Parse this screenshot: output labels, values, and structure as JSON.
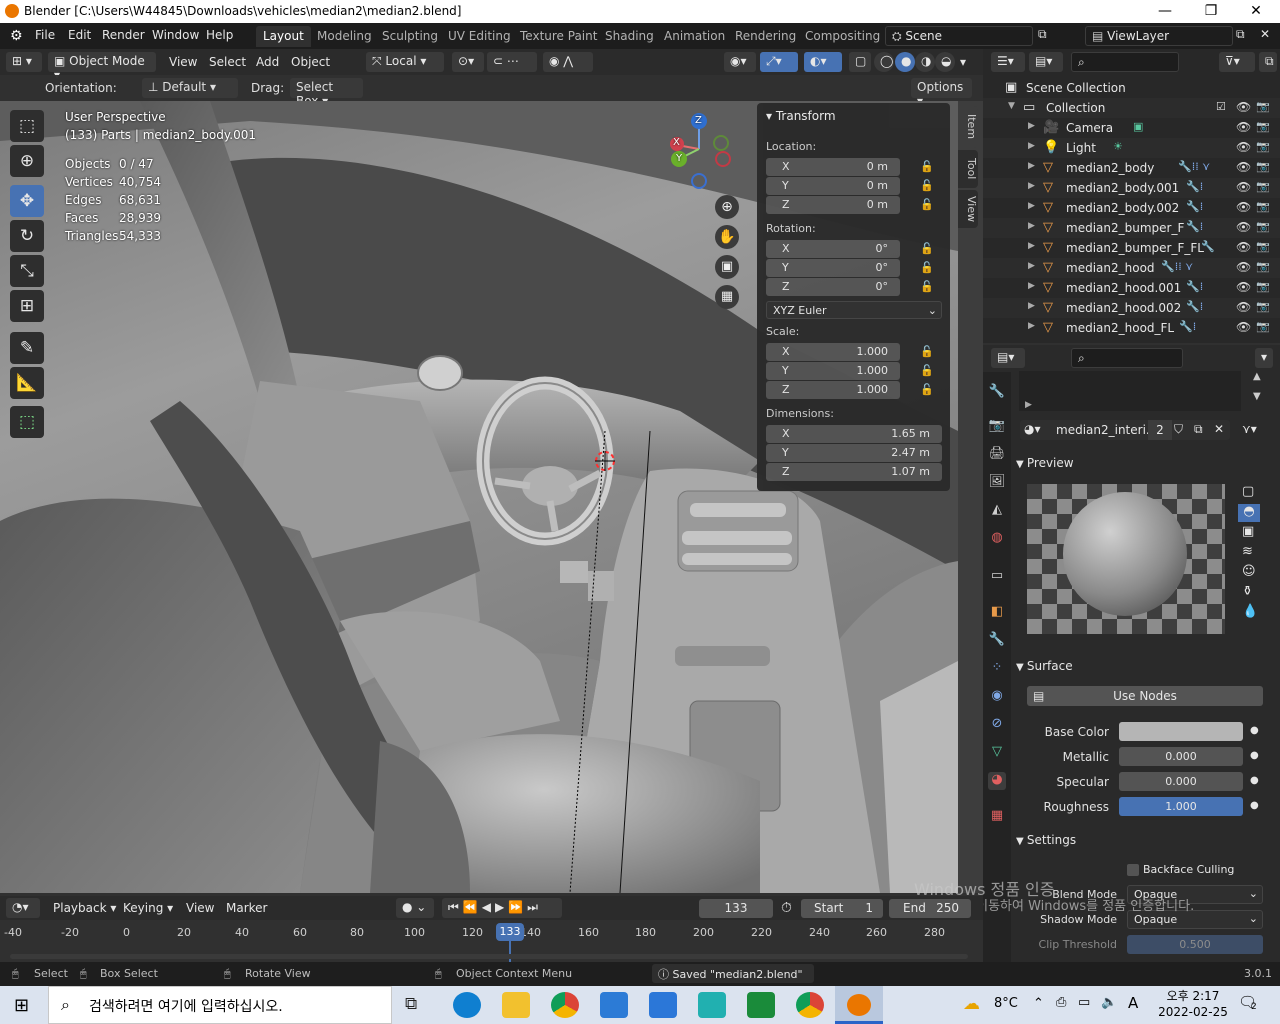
{
  "window": {
    "title": "Blender [C:\\Users\\W44845\\Downloads\\vehicles\\median2\\median2.blend]",
    "min": "—",
    "max": "❐",
    "close": "✕"
  },
  "menu": [
    "File",
    "Edit",
    "Render",
    "Window",
    "Help"
  ],
  "workspaces": [
    "Layout",
    "Modeling",
    "Sculpting",
    "UV Editing",
    "Texture Paint",
    "Shading",
    "Animation",
    "Rendering",
    "Compositing"
  ],
  "scene": {
    "name": "Scene",
    "view_layer": "ViewLayer"
  },
  "viewport_header": {
    "mode": "Object Mode",
    "menus": [
      "View",
      "Select",
      "Add",
      "Object"
    ],
    "transform_space": "Local"
  },
  "tool_settings": {
    "orientation_label": "Orientation:",
    "orientation": "Default",
    "drag_label": "Drag:",
    "drag": "Select Box",
    "options": "Options"
  },
  "viewport_info": {
    "perspective": "User Perspective",
    "object": "(133) Parts | median2_body.001",
    "stats": [
      {
        "label": "Objects",
        "value": "0 / 47"
      },
      {
        "label": "Vertices",
        "value": "40,754"
      },
      {
        "label": "Edges",
        "value": "68,631"
      },
      {
        "label": "Faces",
        "value": "28,939"
      },
      {
        "label": "Triangles",
        "value": "54,333"
      }
    ]
  },
  "gizmo": {
    "x": "X",
    "y": "Y",
    "z": "Z"
  },
  "npanel": {
    "header": "Transform",
    "location_label": "Location:",
    "location": [
      {
        "axis": "X",
        "value": "0 m"
      },
      {
        "axis": "Y",
        "value": "0 m"
      },
      {
        "axis": "Z",
        "value": "0 m"
      }
    ],
    "rotation_label": "Rotation:",
    "rotation": [
      {
        "axis": "X",
        "value": "0°"
      },
      {
        "axis": "Y",
        "value": "0°"
      },
      {
        "axis": "Z",
        "value": "0°"
      }
    ],
    "rotation_mode": "XYZ Euler",
    "scale_label": "Scale:",
    "scale": [
      {
        "axis": "X",
        "value": "1.000"
      },
      {
        "axis": "Y",
        "value": "1.000"
      },
      {
        "axis": "Z",
        "value": "1.000"
      }
    ],
    "dimensions_label": "Dimensions:",
    "dimensions": [
      {
        "axis": "X",
        "value": "1.65 m"
      },
      {
        "axis": "Y",
        "value": "2.47 m"
      },
      {
        "axis": "Z",
        "value": "1.07 m"
      }
    ],
    "tabs": [
      "Item",
      "Tool",
      "View"
    ]
  },
  "outliner": {
    "scene_collection": "Scene Collection",
    "collection": "Collection",
    "items": [
      {
        "name": "Camera",
        "icon": "camera-icon"
      },
      {
        "name": "Light",
        "icon": "light-icon"
      },
      {
        "name": "median2_body",
        "icon": "mesh-icon"
      },
      {
        "name": "median2_body.001",
        "icon": "mesh-icon"
      },
      {
        "name": "median2_body.002",
        "icon": "mesh-icon"
      },
      {
        "name": "median2_bumper_F",
        "icon": "mesh-icon"
      },
      {
        "name": "median2_bumper_F_FL",
        "icon": "mesh-icon"
      },
      {
        "name": "median2_hood",
        "icon": "mesh-icon"
      },
      {
        "name": "median2_hood.001",
        "icon": "mesh-icon"
      },
      {
        "name": "median2_hood.002",
        "icon": "mesh-icon"
      },
      {
        "name": "median2_hood_FL",
        "icon": "mesh-icon"
      }
    ]
  },
  "properties": {
    "material_name": "median2_interi...",
    "material_users": "2",
    "preview_label": "Preview",
    "surface_label": "Surface",
    "use_nodes": "Use Nodes",
    "fields": [
      {
        "label": "Base Color",
        "value": ""
      },
      {
        "label": "Metallic",
        "value": "0.000"
      },
      {
        "label": "Specular",
        "value": "0.000"
      },
      {
        "label": "Roughness",
        "value": "1.000"
      }
    ],
    "settings_label": "Settings",
    "backface_culling": "Backface Culling",
    "blend_mode_label": "Blend Mode",
    "blend_mode": "Opaque",
    "shadow_mode_label": "Shadow Mode",
    "shadow_mode": "Opaque",
    "clip_threshold_label": "Clip Threshold",
    "clip_threshold": "0.500"
  },
  "timeline": {
    "menus": [
      "Playback",
      "Keying",
      "View",
      "Marker"
    ],
    "current_frame": "133",
    "start_label": "Start",
    "start": "1",
    "end_label": "End",
    "end": "250",
    "ticks": [
      "-40",
      "-20",
      "0",
      "20",
      "40",
      "60",
      "80",
      "100",
      "120",
      "140",
      "160",
      "180",
      "200",
      "220",
      "240",
      "260",
      "280"
    ]
  },
  "status": {
    "select": "Select",
    "box_select": "Box Select",
    "rotate_view": "Rotate View",
    "context_menu": "Object Context Menu",
    "message": "Saved \"median2.blend\"",
    "version": "3.0.1"
  },
  "watermark": {
    "line1": "Windows 정품 인증",
    "line2": "[설정]으로 이동하여 Windows를 정품 인증합니다."
  },
  "taskbar": {
    "search_placeholder": "검색하려면 여기에 입력하십시오.",
    "temperature": "8°C",
    "ime": "A",
    "time": "오후 2:17",
    "date": "2022-02-25",
    "notif_count": "2"
  },
  "colors": {
    "accent": "#4772b3",
    "blender_orange": "#ea7600"
  }
}
